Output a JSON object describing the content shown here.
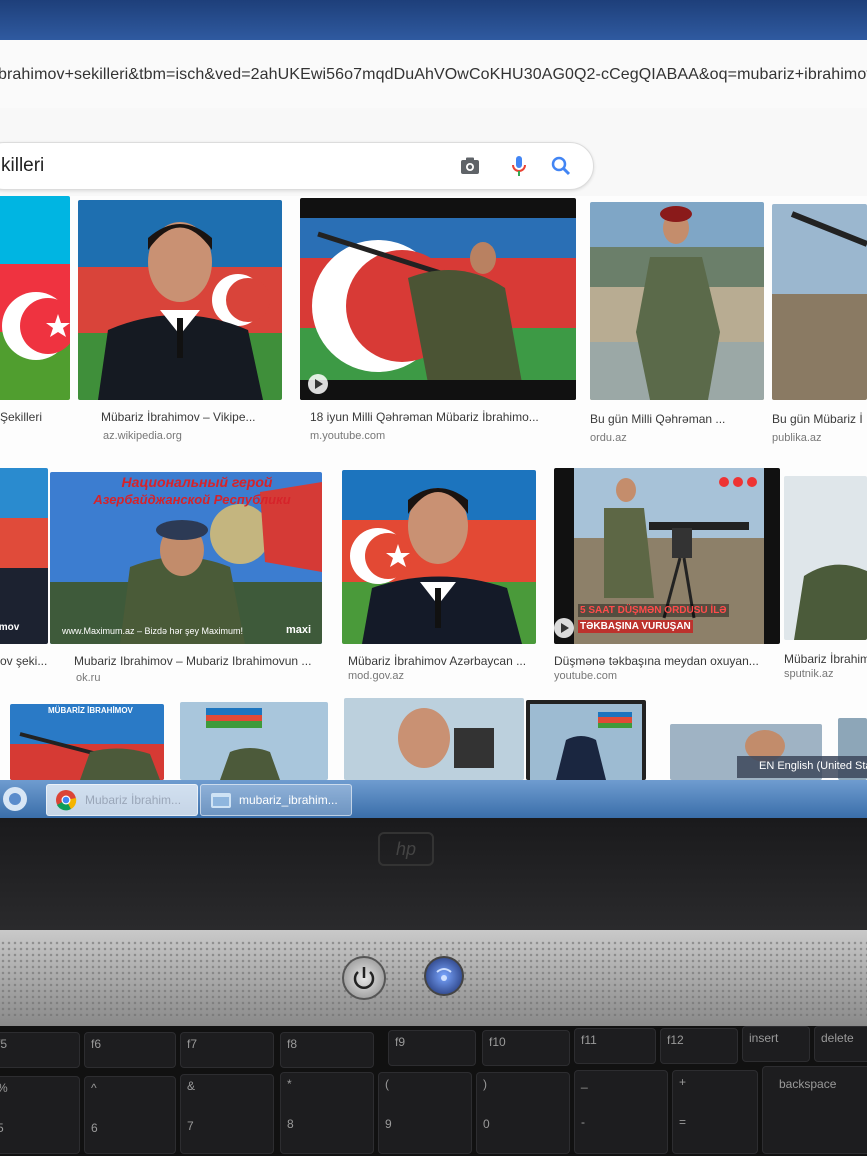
{
  "browser": {
    "url": "brahimov+sekilleri&tbm=isch&ved=2ahUKEwi56o7mqdDuAhVOwCoKHU30AG0Q2-cCegQIABAA&oq=mubariz+ibrahimov",
    "search_query": "killeri",
    "icons": [
      "camera-icon",
      "microphone-icon",
      "search-icon"
    ]
  },
  "results": {
    "row1": [
      {
        "caption": "Şekilleri",
        "source": ""
      },
      {
        "caption": "Mübariz İbrahimov – Vikipe...",
        "source": "az.wikipedia.org"
      },
      {
        "caption": "18 iyun Milli Qəhrəman Mübariz İbrahimo...",
        "source": "m.youtube.com"
      },
      {
        "caption": "Bu gün Milli Qəhrəman ...",
        "source": "ordu.az"
      },
      {
        "caption": "Bu gün Mübariz İ",
        "source": "publika.az"
      }
    ],
    "row2": [
      {
        "caption": "ov şeki...",
        "source": ""
      },
      {
        "caption": "Mubariz Ibrahimov – Mubariz Ibrahimovun ...",
        "source": "ok.ru"
      },
      {
        "caption": "Mübariz İbrahimov Azərbaycan ...",
        "source": "mod.gov.az"
      },
      {
        "caption": "Düşmənə təkbaşına meydan oxuyan...",
        "source": "youtube.com"
      },
      {
        "caption": "Mübariz İbrahim",
        "source": "sputnik.az"
      }
    ],
    "thumb_texts": {
      "russian_banner_line1": "Национальный герой",
      "russian_banner_line2": "Азербайджанской Республики",
      "maximum_watermark": "www.Maximum.az – Bizdə hər şey Maximum!",
      "maximum_logo": "maxi",
      "video_overlay_line1": "5 SAAT DÜŞMƏN ORDUSU İLƏ",
      "video_overlay_line2": "TƏKBAŞINA VURUŞAN",
      "row3_banner": "MÜBARİZ İBRAHİMOV",
      "left_thumb_label": "imov"
    }
  },
  "taskbar": {
    "items": [
      {
        "label": "Mubariz İbrahim..."
      },
      {
        "label": "mubariz_ibrahim..."
      }
    ],
    "language": "EN English (United Sta"
  },
  "laptop": {
    "keys": [
      "f5",
      "f6",
      "f7",
      "f8",
      "f9",
      "f10",
      "f11",
      "f12",
      "insert",
      "delete",
      "%",
      "5",
      "^",
      "6",
      "&",
      "7",
      "*",
      "8",
      "(",
      "9",
      ")",
      "0",
      "_",
      "-",
      "+",
      "=",
      "backspace"
    ]
  },
  "colors": {
    "az_blue": "#00b5e2",
    "az_red": "#ef3340",
    "az_green": "#509e2f",
    "taskbar_blue": "#3a6eaa"
  }
}
